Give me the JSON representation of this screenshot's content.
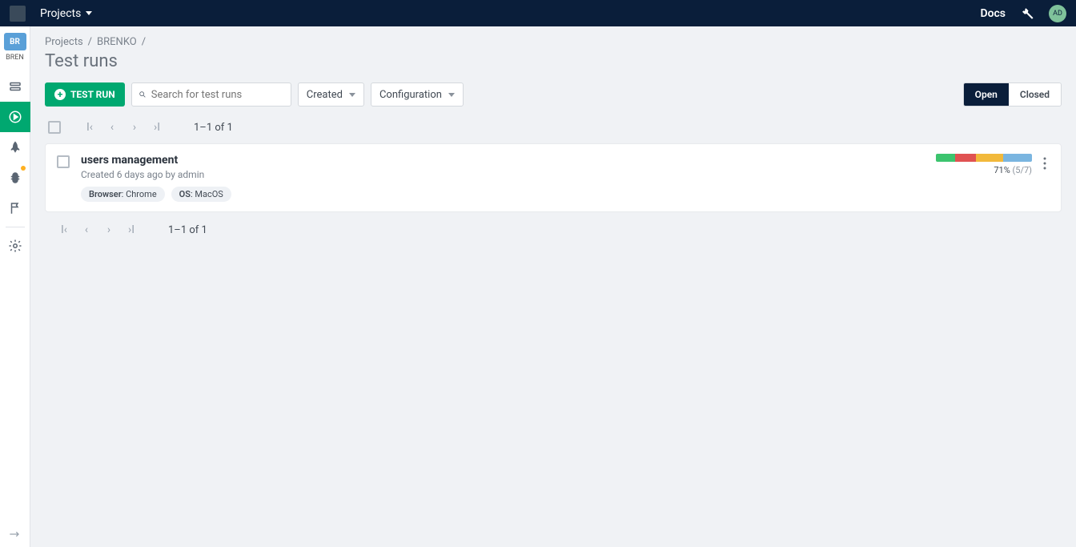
{
  "topbar": {
    "projects_label": "Projects",
    "docs_label": "Docs",
    "avatar_initials": "AD"
  },
  "sidebar": {
    "project_badge": "BR",
    "project_label": "BREN"
  },
  "breadcrumb": {
    "item1": "Projects",
    "sep": "/",
    "item2": "BRENKO"
  },
  "page_title": "Test runs",
  "toolbar": {
    "test_run_label": "TEST RUN",
    "search_placeholder": "Search for test runs",
    "created_label": "Created",
    "configuration_label": "Configuration",
    "open_label": "Open",
    "closed_label": "Closed"
  },
  "pagination": {
    "range_top": "1–1 of 1",
    "range_bottom": "1–1 of 1"
  },
  "run": {
    "title": "users management",
    "meta": "Created 6 days ago by admin",
    "browser_label": "Browser",
    "browser_value": ": Chrome",
    "os_label": "OS",
    "os_value": ": MacOS",
    "percent": "71%",
    "fraction": " (5/7)",
    "progress": {
      "green": 20,
      "red": 22,
      "yellow": 28,
      "blue": 30
    }
  }
}
